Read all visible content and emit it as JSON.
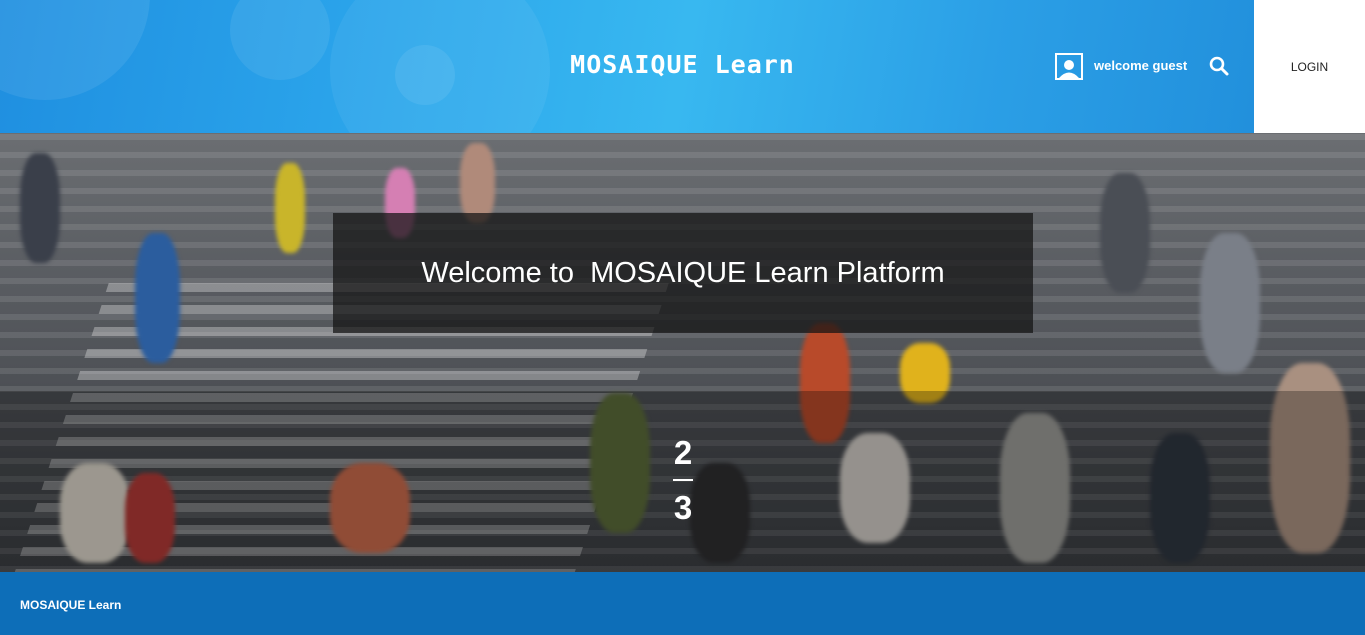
{
  "header": {
    "brand": "MOSAIQUE Learn",
    "welcome_text": "welcome guest",
    "login_label": "LOGIN",
    "icons": [
      "user-icon",
      "search-icon"
    ]
  },
  "hero": {
    "title": "Welcome to  MOSAIQUE Learn Platform",
    "slide_current": "2",
    "slide_total": "3"
  },
  "footer": {
    "brand": "MOSAIQUE Learn"
  },
  "colors": {
    "header_blue": "#2aa3ea",
    "footer_blue": "#0d6eb8",
    "panel": "#141414"
  }
}
